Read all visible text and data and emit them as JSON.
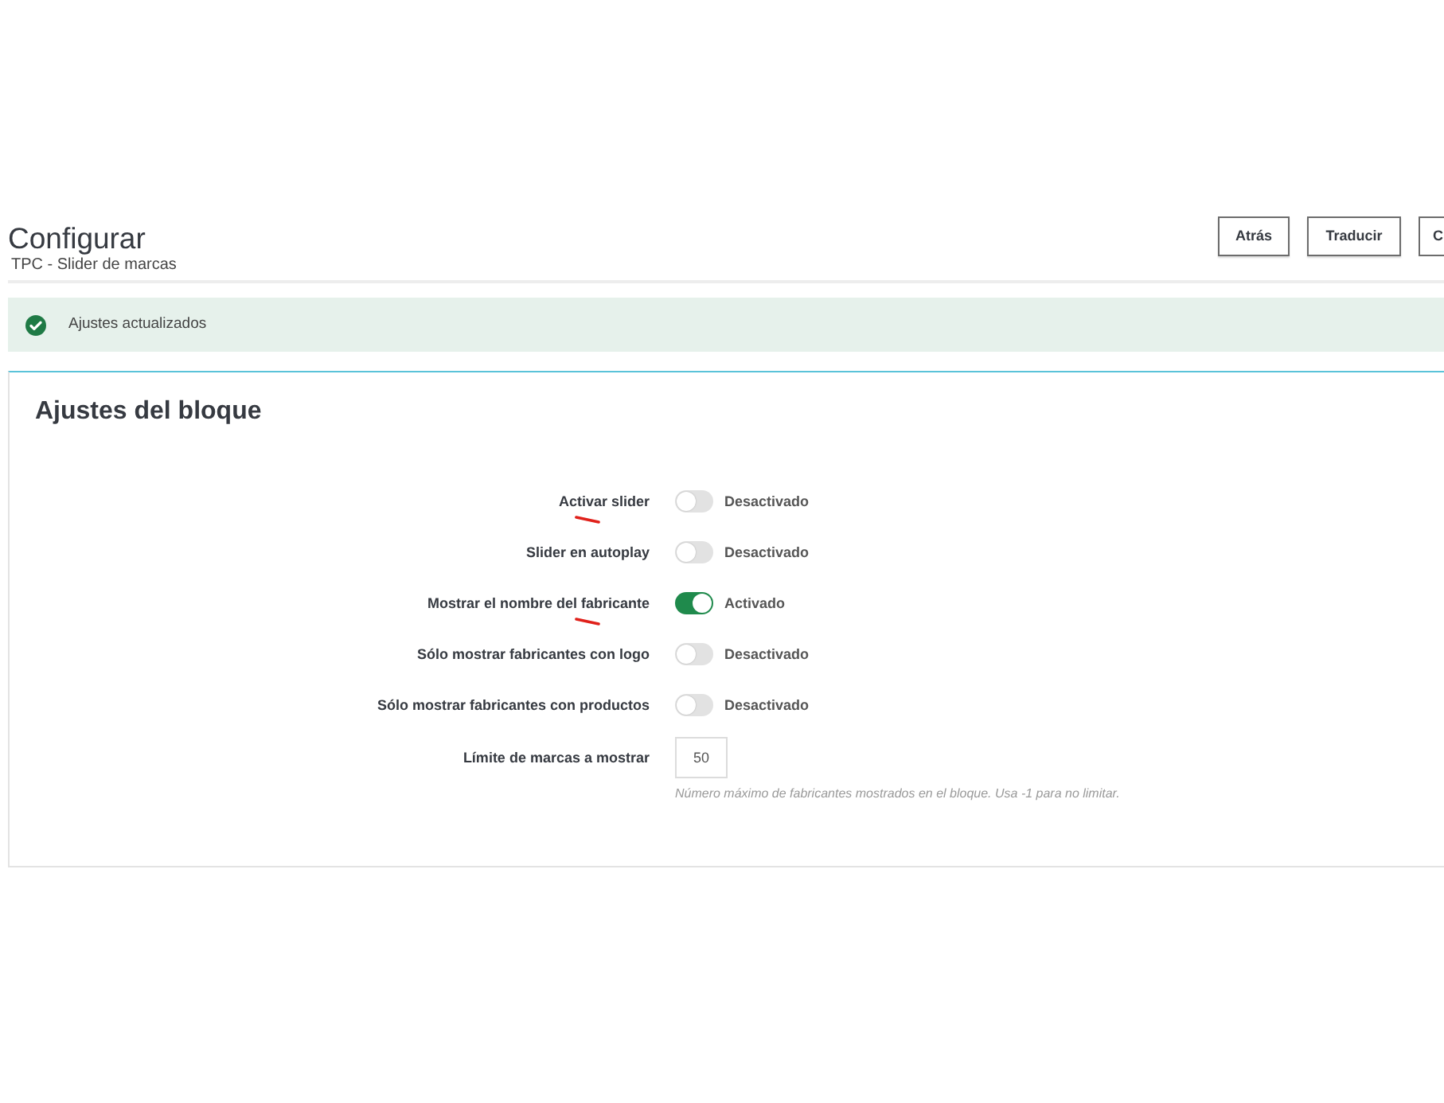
{
  "header": {
    "title": "Configurar",
    "subtitle": "TPC - Slider de marcas",
    "buttons": [
      {
        "label": "Atrás"
      },
      {
        "label": "Traducir"
      },
      {
        "label": "C"
      }
    ]
  },
  "alert": {
    "kind": "success",
    "message": "Ajustes actualizados"
  },
  "panel": {
    "title": "Ajustes del bloque",
    "fields": [
      {
        "kind": "switch",
        "label": "Activar slider",
        "on": false,
        "status": "Desactivado",
        "annotated": true
      },
      {
        "kind": "switch",
        "label": "Slider en autoplay",
        "on": false,
        "status": "Desactivado",
        "annotated": false
      },
      {
        "kind": "switch",
        "label": "Mostrar el nombre del fabricante",
        "on": true,
        "status": "Activado",
        "annotated": true
      },
      {
        "kind": "switch",
        "label": "Sólo mostrar fabricantes con logo",
        "on": false,
        "status": "Desactivado",
        "annotated": false
      },
      {
        "kind": "switch",
        "label": "Sólo mostrar fabricantes con productos",
        "on": false,
        "status": "Desactivado",
        "annotated": false
      },
      {
        "kind": "number",
        "label": "Límite de marcas a mostrar",
        "value": "50",
        "help": "Número máximo de fabricantes mostrados en el bloque. Usa -1 para no limitar."
      }
    ]
  }
}
